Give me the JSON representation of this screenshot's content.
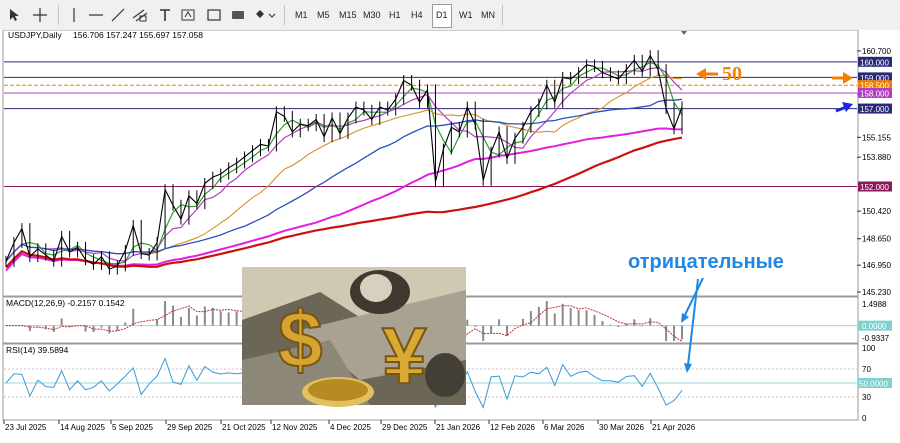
{
  "toolbar": {
    "timeframes": [
      "M1",
      "M5",
      "M15",
      "M30",
      "H1",
      "H4",
      "D1",
      "W1",
      "MN"
    ],
    "active_timeframe": "D1"
  },
  "colors": {
    "price": "#000000",
    "ma_fast_green": "#2aa02a",
    "ma_violet": "#b040c0",
    "ma_orange": "#d89028",
    "ma_blue": "#2a50c0",
    "ma_magenta": "#e020e0",
    "ma_red": "#cc1010",
    "macd": "#c03030",
    "rsi": "#3a9ad8",
    "annotation_blue": "#1e88e5",
    "annotation_orange": "#f08000"
  },
  "chart_data": {
    "type": "line",
    "header": {
      "symbol": "USDJPY,Daily",
      "ohlc": "156.706 157.247 155.697 157.058"
    },
    "x_dates": [
      "23 Jul 2025",
      "14 Aug 2025",
      "5 Sep 2025",
      "29 Sep 2025",
      "21 Oct 2025",
      "12 Nov 2025",
      "4 Dec 2025",
      "29 Dec 2025",
      "21 Jan 2026",
      "12 Feb 2026",
      "6 Mar 2026",
      "30 Mar 2026",
      "21 Apr 2026"
    ],
    "y_ticks": [
      "160.700",
      "157.925",
      "155.155",
      "153.880",
      "150.420",
      "148.650",
      "146.950",
      "145.230"
    ],
    "ylim": [
      145.23,
      161.4
    ],
    "price_series": [
      147.2,
      148.4,
      149.3,
      147.5,
      148.0,
      147.6,
      147.2,
      148.8,
      147.8,
      148.1,
      147.3,
      147.0,
      147.5,
      146.7,
      146.9,
      147.9,
      149.5,
      147.7,
      147.6,
      148.4,
      151.8,
      150.8,
      149.9,
      151.4,
      150.9,
      152.2,
      152.6,
      152.8,
      153.2,
      153.5,
      153.9,
      154.3,
      154.7,
      154.6,
      156.8,
      156.5,
      155.5,
      156.0,
      155.9,
      156.3,
      155.2,
      156.4,
      155.4,
      156.4,
      157.1,
      156.9,
      156.3,
      157.1,
      156.9,
      157.6,
      158.8,
      158.5,
      157.4,
      158.2,
      152.3,
      154.4,
      155.8,
      155.5,
      157.1,
      156.0,
      152.4,
      154.2,
      155.5,
      153.8,
      155.1,
      155.8,
      156.8,
      157.3,
      158.5,
      157.4,
      159.0,
      158.9,
      159.3,
      159.8,
      159.7,
      159.3,
      159.1,
      158.9,
      159.5,
      160.1,
      159.4,
      160.4,
      159.5,
      157.0,
      155.7,
      157.1
    ],
    "price_levels": [
      {
        "value": 160.0,
        "label": "160.000",
        "color": "#2a2a7a"
      },
      {
        "value": 159.0,
        "label": "159.000",
        "color": "#2a2a7a"
      },
      {
        "value": 158.5,
        "label": "158.500",
        "color": "#f08000"
      },
      {
        "value": 158.0,
        "label": "158.000",
        "color": "#b040c0"
      },
      {
        "value": 157.0,
        "label": "157.000",
        "color": "#2a2a7a"
      },
      {
        "value": 152.0,
        "label": "152.000",
        "color": "#8a1a5a"
      }
    ],
    "macd": {
      "label": "MACD(12,26,9) -0.2157 0.1542",
      "ticks": [
        "1.4988",
        "0.0000",
        "-0.9337"
      ],
      "ylim": [
        -0.9337,
        1.4988
      ]
    },
    "rsi": {
      "label": "RSI(14) 39.5894",
      "ticks": [
        "100",
        "70",
        "50.0000",
        "30",
        "0"
      ],
      "ylim": [
        0,
        100
      ],
      "value": 39.5894
    }
  },
  "annotations": {
    "orange_label": "50",
    "blue_label": "отрицательные"
  }
}
